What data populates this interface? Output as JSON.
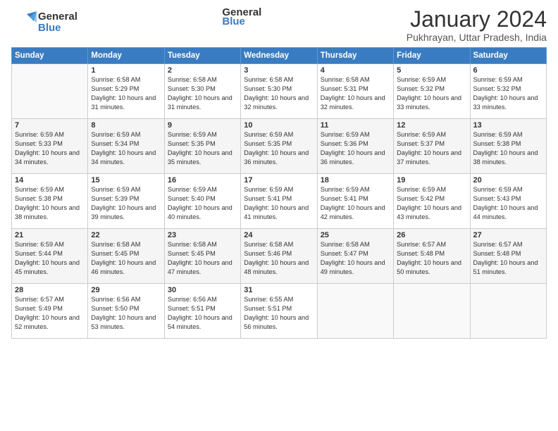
{
  "header": {
    "logo_text_general": "General",
    "logo_text_blue": "Blue",
    "month_title": "January 2024",
    "location": "Pukhrayan, Uttar Pradesh, India"
  },
  "days_of_week": [
    "Sunday",
    "Monday",
    "Tuesday",
    "Wednesday",
    "Thursday",
    "Friday",
    "Saturday"
  ],
  "weeks": [
    [
      {
        "num": "",
        "sunrise": "",
        "sunset": "",
        "daylight": ""
      },
      {
        "num": "1",
        "sunrise": "Sunrise: 6:58 AM",
        "sunset": "Sunset: 5:29 PM",
        "daylight": "Daylight: 10 hours and 31 minutes."
      },
      {
        "num": "2",
        "sunrise": "Sunrise: 6:58 AM",
        "sunset": "Sunset: 5:30 PM",
        "daylight": "Daylight: 10 hours and 31 minutes."
      },
      {
        "num": "3",
        "sunrise": "Sunrise: 6:58 AM",
        "sunset": "Sunset: 5:30 PM",
        "daylight": "Daylight: 10 hours and 32 minutes."
      },
      {
        "num": "4",
        "sunrise": "Sunrise: 6:58 AM",
        "sunset": "Sunset: 5:31 PM",
        "daylight": "Daylight: 10 hours and 32 minutes."
      },
      {
        "num": "5",
        "sunrise": "Sunrise: 6:59 AM",
        "sunset": "Sunset: 5:32 PM",
        "daylight": "Daylight: 10 hours and 33 minutes."
      },
      {
        "num": "6",
        "sunrise": "Sunrise: 6:59 AM",
        "sunset": "Sunset: 5:32 PM",
        "daylight": "Daylight: 10 hours and 33 minutes."
      }
    ],
    [
      {
        "num": "7",
        "sunrise": "Sunrise: 6:59 AM",
        "sunset": "Sunset: 5:33 PM",
        "daylight": "Daylight: 10 hours and 34 minutes."
      },
      {
        "num": "8",
        "sunrise": "Sunrise: 6:59 AM",
        "sunset": "Sunset: 5:34 PM",
        "daylight": "Daylight: 10 hours and 34 minutes."
      },
      {
        "num": "9",
        "sunrise": "Sunrise: 6:59 AM",
        "sunset": "Sunset: 5:35 PM",
        "daylight": "Daylight: 10 hours and 35 minutes."
      },
      {
        "num": "10",
        "sunrise": "Sunrise: 6:59 AM",
        "sunset": "Sunset: 5:35 PM",
        "daylight": "Daylight: 10 hours and 36 minutes."
      },
      {
        "num": "11",
        "sunrise": "Sunrise: 6:59 AM",
        "sunset": "Sunset: 5:36 PM",
        "daylight": "Daylight: 10 hours and 36 minutes."
      },
      {
        "num": "12",
        "sunrise": "Sunrise: 6:59 AM",
        "sunset": "Sunset: 5:37 PM",
        "daylight": "Daylight: 10 hours and 37 minutes."
      },
      {
        "num": "13",
        "sunrise": "Sunrise: 6:59 AM",
        "sunset": "Sunset: 5:38 PM",
        "daylight": "Daylight: 10 hours and 38 minutes."
      }
    ],
    [
      {
        "num": "14",
        "sunrise": "Sunrise: 6:59 AM",
        "sunset": "Sunset: 5:38 PM",
        "daylight": "Daylight: 10 hours and 38 minutes."
      },
      {
        "num": "15",
        "sunrise": "Sunrise: 6:59 AM",
        "sunset": "Sunset: 5:39 PM",
        "daylight": "Daylight: 10 hours and 39 minutes."
      },
      {
        "num": "16",
        "sunrise": "Sunrise: 6:59 AM",
        "sunset": "Sunset: 5:40 PM",
        "daylight": "Daylight: 10 hours and 40 minutes."
      },
      {
        "num": "17",
        "sunrise": "Sunrise: 6:59 AM",
        "sunset": "Sunset: 5:41 PM",
        "daylight": "Daylight: 10 hours and 41 minutes."
      },
      {
        "num": "18",
        "sunrise": "Sunrise: 6:59 AM",
        "sunset": "Sunset: 5:41 PM",
        "daylight": "Daylight: 10 hours and 42 minutes."
      },
      {
        "num": "19",
        "sunrise": "Sunrise: 6:59 AM",
        "sunset": "Sunset: 5:42 PM",
        "daylight": "Daylight: 10 hours and 43 minutes."
      },
      {
        "num": "20",
        "sunrise": "Sunrise: 6:59 AM",
        "sunset": "Sunset: 5:43 PM",
        "daylight": "Daylight: 10 hours and 44 minutes."
      }
    ],
    [
      {
        "num": "21",
        "sunrise": "Sunrise: 6:59 AM",
        "sunset": "Sunset: 5:44 PM",
        "daylight": "Daylight: 10 hours and 45 minutes."
      },
      {
        "num": "22",
        "sunrise": "Sunrise: 6:58 AM",
        "sunset": "Sunset: 5:45 PM",
        "daylight": "Daylight: 10 hours and 46 minutes."
      },
      {
        "num": "23",
        "sunrise": "Sunrise: 6:58 AM",
        "sunset": "Sunset: 5:45 PM",
        "daylight": "Daylight: 10 hours and 47 minutes."
      },
      {
        "num": "24",
        "sunrise": "Sunrise: 6:58 AM",
        "sunset": "Sunset: 5:46 PM",
        "daylight": "Daylight: 10 hours and 48 minutes."
      },
      {
        "num": "25",
        "sunrise": "Sunrise: 6:58 AM",
        "sunset": "Sunset: 5:47 PM",
        "daylight": "Daylight: 10 hours and 49 minutes."
      },
      {
        "num": "26",
        "sunrise": "Sunrise: 6:57 AM",
        "sunset": "Sunset: 5:48 PM",
        "daylight": "Daylight: 10 hours and 50 minutes."
      },
      {
        "num": "27",
        "sunrise": "Sunrise: 6:57 AM",
        "sunset": "Sunset: 5:48 PM",
        "daylight": "Daylight: 10 hours and 51 minutes."
      }
    ],
    [
      {
        "num": "28",
        "sunrise": "Sunrise: 6:57 AM",
        "sunset": "Sunset: 5:49 PM",
        "daylight": "Daylight: 10 hours and 52 minutes."
      },
      {
        "num": "29",
        "sunrise": "Sunrise: 6:56 AM",
        "sunset": "Sunset: 5:50 PM",
        "daylight": "Daylight: 10 hours and 53 minutes."
      },
      {
        "num": "30",
        "sunrise": "Sunrise: 6:56 AM",
        "sunset": "Sunset: 5:51 PM",
        "daylight": "Daylight: 10 hours and 54 minutes."
      },
      {
        "num": "31",
        "sunrise": "Sunrise: 6:55 AM",
        "sunset": "Sunset: 5:51 PM",
        "daylight": "Daylight: 10 hours and 56 minutes."
      },
      {
        "num": "",
        "sunrise": "",
        "sunset": "",
        "daylight": ""
      },
      {
        "num": "",
        "sunrise": "",
        "sunset": "",
        "daylight": ""
      },
      {
        "num": "",
        "sunrise": "",
        "sunset": "",
        "daylight": ""
      }
    ]
  ]
}
